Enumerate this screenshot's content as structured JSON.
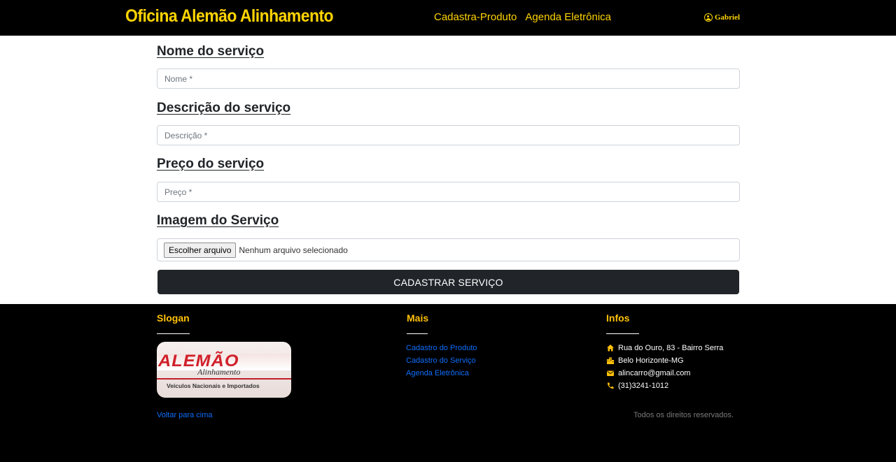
{
  "navbar": {
    "brand": "Oficina Alemão Alinhamento",
    "links": [
      "Cadastra-Produto",
      "Agenda Eletrônica"
    ],
    "user": "Gabriel"
  },
  "form": {
    "fields": [
      {
        "label": "Nome do serviço",
        "placeholder": "Nome *",
        "value": ""
      },
      {
        "label": "Descrição do serviço",
        "placeholder": "Descrição *",
        "value": ""
      },
      {
        "label": "Preço do serviço",
        "placeholder": "Preço *",
        "value": ""
      }
    ],
    "image": {
      "label": "Imagem do Serviço",
      "button": "Escolher arquivo",
      "status": "Nenhum arquivo selecionado"
    },
    "submit": "CADASTRAR SERVIÇO"
  },
  "footer": {
    "slogan": {
      "title": "Slogan",
      "logo_text": "ALEMÃO",
      "logo_script": "Alinhamento",
      "logo_sub": "Veículos Nacionais e Importados",
      "back_to_top": "Voltar para cima"
    },
    "mais": {
      "title": "Mais",
      "links": [
        "Cadastro do Produto",
        "Cadastro do Serviço",
        "Agenda Eletrônica"
      ]
    },
    "infos": {
      "title": "Infos",
      "items": [
        {
          "icon": "home-icon",
          "text": "Rua do Ouro, 83 - Bairro Serra"
        },
        {
          "icon": "city-icon",
          "text": "Belo Horizonte-MG"
        },
        {
          "icon": "envelope-icon",
          "text": "alincarro@gmail.com"
        },
        {
          "icon": "phone-icon",
          "text": "(31)3241-1012"
        }
      ]
    },
    "rights": "Todos os direitos reservados."
  },
  "colors": {
    "brand_yellow": "#ffd400",
    "footer_title": "#ffc107",
    "link_blue": "#0d6efd",
    "button_dark": "#212529"
  }
}
